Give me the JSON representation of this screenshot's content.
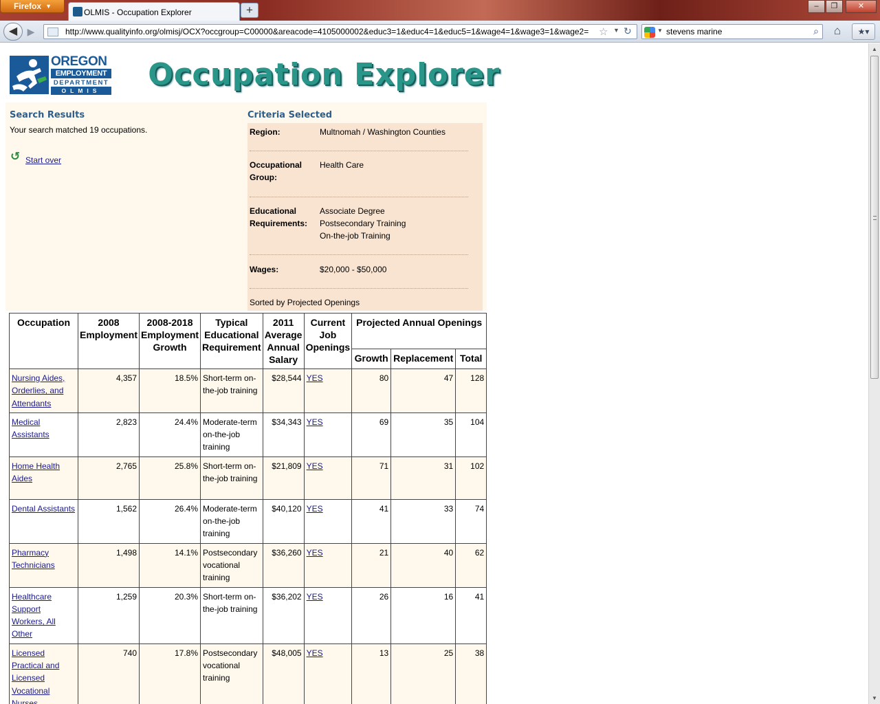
{
  "browser": {
    "menu_button": "Firefox",
    "tab_title": "OLMIS - Occupation Explorer",
    "new_tab": "+",
    "url": "http://www.qualityinfo.org/olmisj/OCX?occgroup=C00000&areacode=4105000002&educ3=1&educ4=1&educ5=1&wage4=1&wage3=1&wage2=",
    "search_value": "stevens marine",
    "icons": [
      "back-icon",
      "forward-icon",
      "star-icon",
      "reload-icon",
      "search-icon",
      "home-icon",
      "bookmarks-icon",
      "minimize-icon",
      "maximize-icon",
      "close-icon"
    ]
  },
  "logo": {
    "line1": "OREGON",
    "line2": "EMPLOYMENT",
    "line3": "DEPARTMENT",
    "line4": "OLMIS"
  },
  "banner": "Occupation Explorer",
  "search_results": {
    "title": "Search Results",
    "count_text": "Your search matched 19 occupations.",
    "start_over": "Start over"
  },
  "criteria": {
    "title": "Criteria Selected",
    "region_label": "Region:",
    "region_value": "Multnomah / Washington Counties",
    "occ_label_1": "Occupational",
    "occ_label_2": "Group:",
    "occ_value": "Health Care",
    "edu_label_1": "Educational",
    "edu_label_2": "Requirements:",
    "edu_values": [
      "Associate Degree",
      "Postsecondary Training",
      "On-the-job Training"
    ],
    "wages_label": "Wages:",
    "wages_value": "$20,000 - $50,000",
    "sorted_by": "Sorted by Projected Openings"
  },
  "table": {
    "headers": {
      "occupation": "Occupation",
      "employment": "2008 Employment",
      "growth": "2008-2018 Employment Growth",
      "education": "Typical Educational Requirement",
      "salary": "2011 Average Annual Salary",
      "openings": "Current Job Openings",
      "projected": "Projected Annual Openings",
      "proj_growth": "Growth",
      "proj_replacement": "Replacement",
      "proj_total": "Total"
    },
    "rows": [
      {
        "occupation": "Nursing Aides, Orderlies, and Attendants",
        "employment": "4,357",
        "growth": "18.5%",
        "education": "Short-term on-the-job training",
        "salary": "$28,544",
        "openings": "YES",
        "proj_growth": "80",
        "proj_replacement": "47",
        "proj_total": "128"
      },
      {
        "occupation": "Medical Assistants",
        "employment": "2,823",
        "growth": "24.4%",
        "education": "Moderate-term on-the-job training",
        "salary": "$34,343",
        "openings": "YES",
        "proj_growth": "69",
        "proj_replacement": "35",
        "proj_total": "104"
      },
      {
        "occupation": "Home Health Aides",
        "employment": "2,765",
        "growth": "25.8%",
        "education": "Short-term on-the-job training",
        "salary": "$21,809",
        "openings": "YES",
        "proj_growth": "71",
        "proj_replacement": "31",
        "proj_total": "102"
      },
      {
        "occupation": "Dental Assistants",
        "employment": "1,562",
        "growth": "26.4%",
        "education": "Moderate-term on-the-job training",
        "salary": "$40,120",
        "openings": "YES",
        "proj_growth": "41",
        "proj_replacement": "33",
        "proj_total": "74"
      },
      {
        "occupation": "Pharmacy Technicians",
        "employment": "1,498",
        "growth": "14.1%",
        "education": "Postsecondary vocational training",
        "salary": "$36,260",
        "openings": "YES",
        "proj_growth": "21",
        "proj_replacement": "40",
        "proj_total": "62"
      },
      {
        "occupation": "Healthcare Support Workers, All Other",
        "employment": "1,259",
        "growth": "20.3%",
        "education": "Short-term on-the-job training",
        "salary": "$36,202",
        "openings": "YES",
        "proj_growth": "26",
        "proj_replacement": "16",
        "proj_total": "41"
      },
      {
        "occupation": "Licensed Practical and Licensed Vocational Nurses",
        "employment": "740",
        "growth": "17.8%",
        "education": "Postsecondary vocational training",
        "salary": "$48,005",
        "openings": "YES",
        "proj_growth": "13",
        "proj_replacement": "25",
        "proj_total": "38"
      }
    ]
  }
}
